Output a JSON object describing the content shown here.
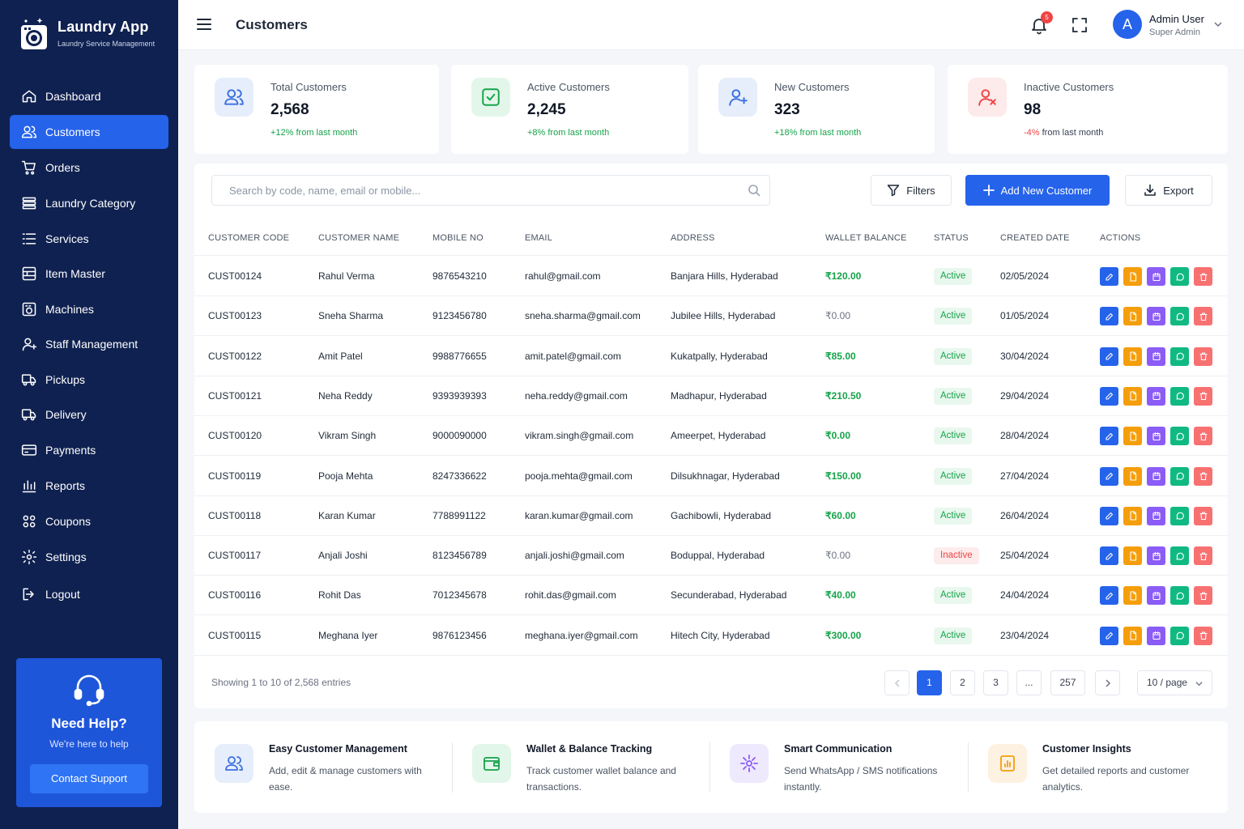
{
  "app": {
    "name": "Laundry App",
    "tagline": "Laundry Service Management"
  },
  "sidebar": {
    "items": [
      {
        "label": "Dashboard",
        "icon": "home-icon"
      },
      {
        "label": "Customers",
        "icon": "users-icon",
        "active": true
      },
      {
        "label": "Orders",
        "icon": "cart-icon"
      },
      {
        "label": "Laundry Category",
        "icon": "category-icon"
      },
      {
        "label": "Services",
        "icon": "list-icon"
      },
      {
        "label": "Item Master",
        "icon": "box-icon"
      },
      {
        "label": "Machines",
        "icon": "machine-icon"
      },
      {
        "label": "Staff Management",
        "icon": "staff-icon"
      },
      {
        "label": "Pickups",
        "icon": "truck-icon"
      },
      {
        "label": "Delivery",
        "icon": "truck-icon"
      },
      {
        "label": "Payments",
        "icon": "card-icon"
      },
      {
        "label": "Reports",
        "icon": "chart-icon"
      },
      {
        "label": "Coupons",
        "icon": "coupon-icon"
      },
      {
        "label": "Settings",
        "icon": "gear-icon"
      },
      {
        "label": "Logout",
        "icon": "logout-icon"
      }
    ],
    "help": {
      "title": "Need Help?",
      "subtitle": "We're here to help",
      "button": "Contact Support"
    }
  },
  "header": {
    "title": "Customers",
    "notifications": "5",
    "user": {
      "initial": "A",
      "name": "Admin User",
      "role": "Super Admin"
    }
  },
  "stats": [
    {
      "label": "Total Customers",
      "value": "2,568",
      "change": "+12% from last month",
      "color": "#3b6fe0",
      "bg": "#e6eefc"
    },
    {
      "label": "Active Customers",
      "value": "2,245",
      "change": "+8% from last month",
      "color": "#16a34a",
      "bg": "#e3f6ea"
    },
    {
      "label": "New Customers",
      "value": "323",
      "change": "+18% from last month",
      "color": "#3b6fe0",
      "bg": "#e6eefc"
    },
    {
      "label": "Inactive Customers",
      "value": "98",
      "change_pct": "-4%",
      "change_text": "from last month",
      "color": "#ef4444",
      "bg": "#fdeaea"
    }
  ],
  "toolbar": {
    "search_placeholder": "Search by code, name, email or mobile...",
    "filters": "Filters",
    "add": "Add New Customer",
    "export": "Export"
  },
  "table": {
    "columns": [
      "CUSTOMER CODE",
      "CUSTOMER NAME",
      "MOBILE NO",
      "EMAIL",
      "ADDRESS",
      "WALLET BALANCE",
      "STATUS",
      "CREATED DATE",
      "ACTIONS"
    ],
    "rows": [
      {
        "code": "CUST00124",
        "name": "Rahul Verma",
        "mobile": "9876543210",
        "email": "rahul@gmail.com",
        "address": "Banjara Hills, Hyderabad",
        "wallet": "₹120.00",
        "wallet_type": "pos",
        "status": "Active",
        "created": "02/05/2024"
      },
      {
        "code": "CUST00123",
        "name": "Sneha Sharma",
        "mobile": "9123456780",
        "email": "sneha.sharma@gmail.com",
        "address": "Jubilee Hills, Hyderabad",
        "wallet": "₹0.00",
        "wallet_type": "zero",
        "status": "Active",
        "created": "01/05/2024"
      },
      {
        "code": "CUST00122",
        "name": "Amit Patel",
        "mobile": "9988776655",
        "email": "amit.patel@gmail.com",
        "address": "Kukatpally, Hyderabad",
        "wallet": "₹85.00",
        "wallet_type": "pos",
        "status": "Active",
        "created": "30/04/2024"
      },
      {
        "code": "CUST00121",
        "name": "Neha Reddy",
        "mobile": "9393939393",
        "email": "neha.reddy@gmail.com",
        "address": "Madhapur, Hyderabad",
        "wallet": "₹210.50",
        "wallet_type": "pos",
        "status": "Active",
        "created": "29/04/2024"
      },
      {
        "code": "CUST00120",
        "name": "Vikram Singh",
        "mobile": "9000090000",
        "email": "vikram.singh@gmail.com",
        "address": "Ameerpet, Hyderabad",
        "wallet": "₹0.00",
        "wallet_type": "pos",
        "status": "Active",
        "created": "28/04/2024"
      },
      {
        "code": "CUST00119",
        "name": "Pooja Mehta",
        "mobile": "8247336622",
        "email": "pooja.mehta@gmail.com",
        "address": "Dilsukhnagar, Hyderabad",
        "wallet": "₹150.00",
        "wallet_type": "pos",
        "status": "Active",
        "created": "27/04/2024"
      },
      {
        "code": "CUST00118",
        "name": "Karan Kumar",
        "mobile": "7788991122",
        "email": "karan.kumar@gmail.com",
        "address": "Gachibowli, Hyderabad",
        "wallet": "₹60.00",
        "wallet_type": "pos",
        "status": "Active",
        "created": "26/04/2024"
      },
      {
        "code": "CUST00117",
        "name": "Anjali Joshi",
        "mobile": "8123456789",
        "email": "anjali.joshi@gmail.com",
        "address": "Boduppal, Hyderabad",
        "wallet": "₹0.00",
        "wallet_type": "zero",
        "status": "Inactive",
        "created": "25/04/2024"
      },
      {
        "code": "CUST00116",
        "name": "Rohit Das",
        "mobile": "7012345678",
        "email": "rohit.das@gmail.com",
        "address": "Secunderabad, Hyderabad",
        "wallet": "₹40.00",
        "wallet_type": "pos",
        "status": "Active",
        "created": "24/04/2024"
      },
      {
        "code": "CUST00115",
        "name": "Meghana Iyer",
        "mobile": "9876123456",
        "email": "meghana.iyer@gmail.com",
        "address": "Hitech City, Hyderabad",
        "wallet": "₹300.00",
        "wallet_type": "pos",
        "status": "Active",
        "created": "23/04/2024"
      }
    ],
    "actions": [
      "edit-icon",
      "document-icon",
      "calendar-icon",
      "whatsapp-icon",
      "trash-icon"
    ]
  },
  "pagination": {
    "showing": "Showing 1 to 10 of 2,568 entries",
    "pages": [
      "1",
      "2",
      "3",
      "...",
      "257"
    ],
    "current": "1",
    "per_page": "10 / page"
  },
  "features": [
    {
      "title": "Easy Customer Management",
      "desc": "Add, edit & manage customers with ease.",
      "color": "#3b6fe0",
      "bg": "#e6eefc",
      "icon": "users-icon"
    },
    {
      "title": "Wallet & Balance Tracking",
      "desc": "Track customer wallet balance and transactions.",
      "color": "#16a34a",
      "bg": "#e3f6ea",
      "icon": "wallet-icon"
    },
    {
      "title": "Smart Communication",
      "desc": "Send WhatsApp / SMS notifications instantly.",
      "color": "#8b5cf6",
      "bg": "#efe9fd",
      "icon": "communication-icon"
    },
    {
      "title": "Customer Insights",
      "desc": "Get detailed reports and customer analytics.",
      "color": "#f59e0b",
      "bg": "#fdf1e1",
      "icon": "report-icon"
    }
  ]
}
